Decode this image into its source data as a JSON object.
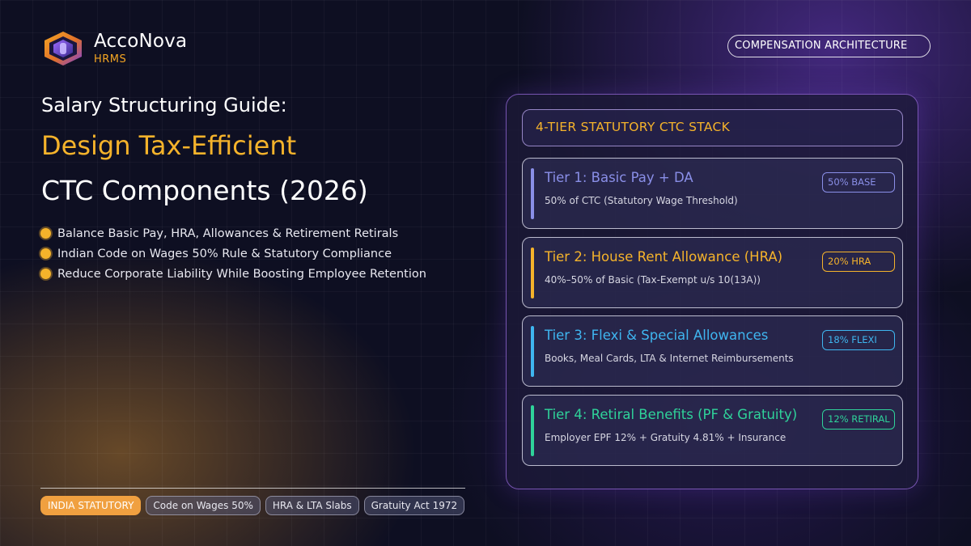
{
  "brand": {
    "name": "AccoNova",
    "sub": "HRMS"
  },
  "header_pill": "COMPENSATION ARCHITECTURE",
  "headline": {
    "line1": "Salary Structuring Guide:",
    "line2": "Design Tax-Efficient",
    "line3": "CTC Components (2026)"
  },
  "bullets": [
    "Balance Basic Pay, HRA, Allowances & Retirement Retirals",
    "Indian Code on Wages 50% Rule & Statutory Compliance",
    "Reduce Corporate Liability While Boosting Employee Retention"
  ],
  "tags": [
    "INDIA STATUTORY",
    "Code on Wages 50%",
    "HRA & LTA Slabs",
    "Gratuity Act 1972"
  ],
  "panel": {
    "header": "4-TIER STATUTORY CTC STACK",
    "tiers": [
      {
        "title": "Tier 1: Basic Pay + DA",
        "desc": "50% of CTC (Statutory Wage Threshold)",
        "badge": "50% BASE",
        "color": "#8a8fe8"
      },
      {
        "title": "Tier 2: House Rent Allowance (HRA)",
        "desc": "40%–50% of Basic (Tax-Exempt u/s 10(13A))",
        "badge": "20% HRA",
        "color": "#f5b32b"
      },
      {
        "title": "Tier 3: Flexi & Special Allowances",
        "desc": "Books, Meal Cards, LTA & Internet Reimbursements",
        "badge": "18% FLEXI",
        "color": "#3fb6f0"
      },
      {
        "title": "Tier 4: Retiral Benefits (PF & Gratuity)",
        "desc": "Employer EPF 12% + Gratuity 4.81% + Insurance",
        "badge": "12% RETIRAL",
        "color": "#2fd39a"
      }
    ]
  }
}
